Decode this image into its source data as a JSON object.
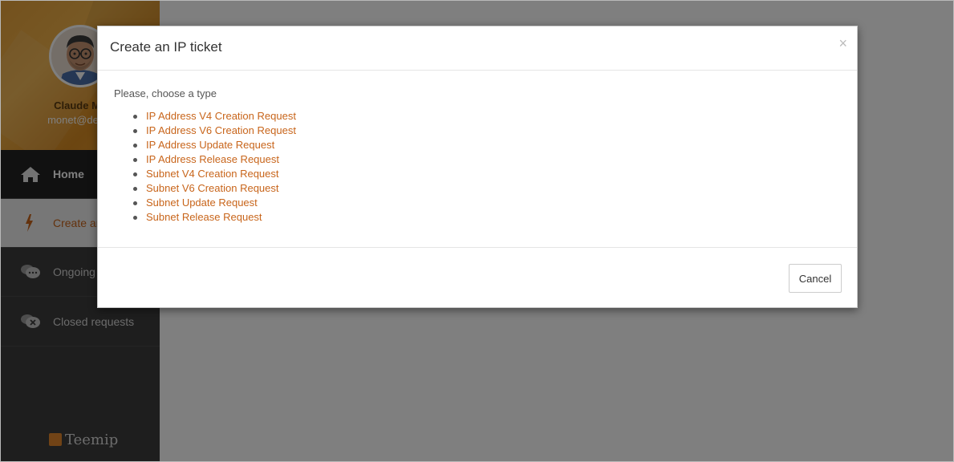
{
  "profile": {
    "name": "Claude Mo",
    "email": "monet@demo"
  },
  "sidebar": {
    "items": [
      {
        "label": "Home",
        "icon": "home-icon"
      },
      {
        "label": "Create an",
        "icon": "lightning-icon"
      },
      {
        "label": "Ongoing",
        "icon": "chat-bubbles-icon"
      },
      {
        "label": "Closed requests",
        "icon": "chat-closed-icon"
      }
    ],
    "brand": "Teemip"
  },
  "modal": {
    "title": "Create an IP ticket",
    "close_label": "×",
    "prompt": "Please, choose a type",
    "types": [
      "IP Address V4 Creation Request",
      "IP Address V6 Creation Request",
      "IP Address Update Request",
      "IP Address Release Request",
      "Subnet V4 Creation Request",
      "Subnet V6 Creation Request",
      "Subnet Update Request",
      "Subnet Release Request"
    ],
    "cancel_label": "Cancel"
  },
  "colors": {
    "accent": "#c8651b",
    "sidebar_bg": "#3d3d3d",
    "profile_bg": "#e8a33b"
  }
}
